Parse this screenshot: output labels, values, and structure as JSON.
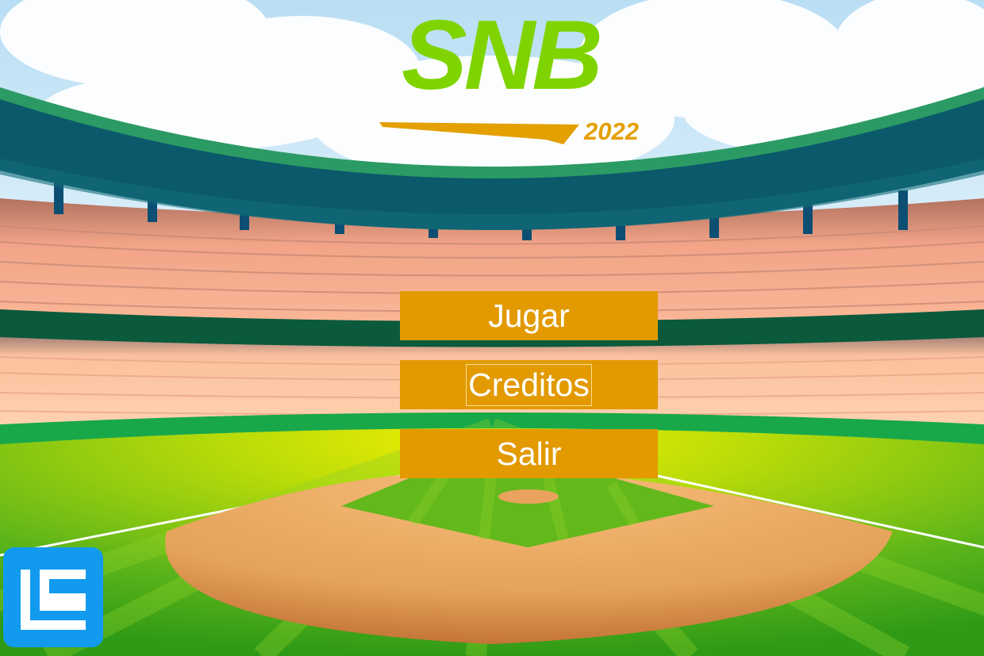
{
  "logo": {
    "title": "SNB",
    "year": "2022"
  },
  "menu": {
    "items": [
      {
        "label": "Jugar"
      },
      {
        "label": "Creditos"
      },
      {
        "label": "Salir"
      }
    ],
    "focused_index": 1
  },
  "colors": {
    "logo_green": "#7fd400",
    "logo_orange": "#e3a000",
    "button_bg": "#e29a00",
    "button_text": "#ffffff",
    "sky": "#d4edf9",
    "roof": "#0b5a6b",
    "stands_upper": "#b77b69",
    "stands_lower": "#fcc6a0",
    "field_green": "#56b11c",
    "infield_dirt": "#e9a35e",
    "brand_badge": "#129aef"
  },
  "icons": {
    "corner_badge": "le-logo-icon"
  }
}
